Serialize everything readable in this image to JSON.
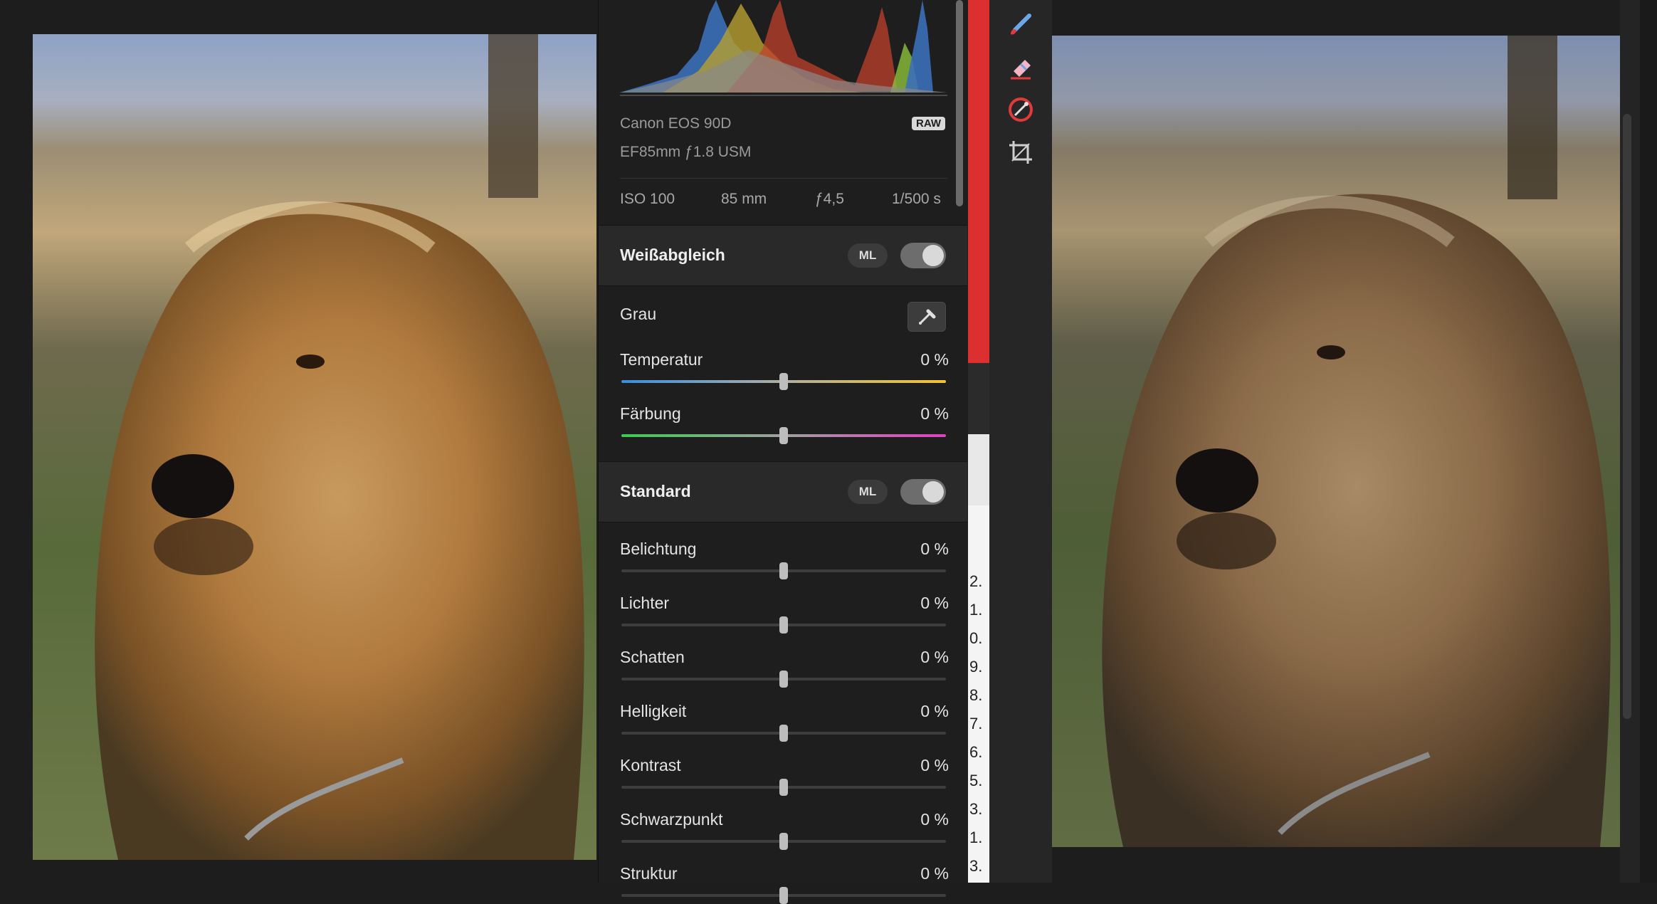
{
  "camera": {
    "body": "Canon EOS 90D",
    "raw_badge": "RAW",
    "lens": "EF85mm ƒ1.8 USM",
    "iso": "ISO 100",
    "focal": "85 mm",
    "aperture": "ƒ4,5",
    "shutter": "1/500 s"
  },
  "white_balance": {
    "title": "Weißabgleich",
    "ml_label": "ML",
    "enabled": true,
    "grey_label": "Grau",
    "picker_icon": "eyedropper-icon",
    "sliders": [
      {
        "label": "Temperatur",
        "value": "0 %",
        "level": 0.5
      },
      {
        "label": "Färbung",
        "value": "0 %",
        "level": 0.5
      }
    ]
  },
  "standard": {
    "title": "Standard",
    "ml_label": "ML",
    "enabled": true,
    "sliders": [
      {
        "label": "Belichtung",
        "value": "0 %",
        "level": 0.5
      },
      {
        "label": "Lichter",
        "value": "0 %",
        "level": 0.5
      },
      {
        "label": "Schatten",
        "value": "0 %",
        "level": 0.5
      },
      {
        "label": "Helligkeit",
        "value": "0 %",
        "level": 0.5
      },
      {
        "label": "Kontrast",
        "value": "0 %",
        "level": 0.5
      },
      {
        "label": "Schwarzpunkt",
        "value": "0 %",
        "level": 0.5
      },
      {
        "label": "Struktur",
        "value": "0 %",
        "level": 0.5
      }
    ]
  },
  "tools": [
    "brush-icon",
    "eraser-icon",
    "curve-pen-icon",
    "crop-icon"
  ],
  "colors": {
    "accent_red": "#e03a3a",
    "temp_start": "#3b8de0",
    "temp_end": "#f2c230",
    "tint_start": "#3ccb52",
    "tint_end": "#e23fc0"
  }
}
